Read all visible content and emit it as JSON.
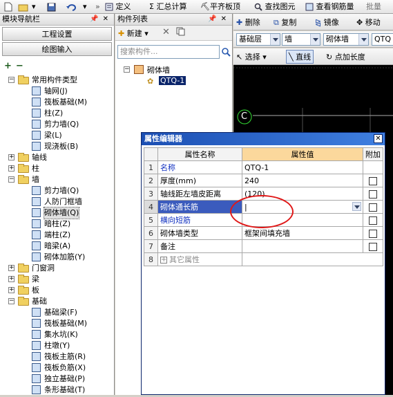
{
  "toolbar": {
    "define_label": "定义",
    "sum_label": "汇总计算",
    "flat_label": "平齐板顶",
    "find_label": "查找图元",
    "view_rebar_label": "查看钢筋量",
    "batch_label": "批量"
  },
  "leftnav": {
    "title": "模块导航栏",
    "project_settings": "工程设置",
    "drawing_input": "绘图输入",
    "tree": [
      {
        "label": "常用构件类型",
        "level": 0,
        "type": "folder",
        "expanded": true
      },
      {
        "label": "轴网(J)",
        "level": 1,
        "type": "item",
        "icon": "grid-icon"
      },
      {
        "label": "筏板基础(M)",
        "level": 1,
        "type": "item",
        "icon": "raft-icon"
      },
      {
        "label": "柱(Z)",
        "level": 1,
        "type": "item",
        "icon": "column-icon"
      },
      {
        "label": "剪力墙(Q)",
        "level": 1,
        "type": "item",
        "icon": "shear-wall-icon"
      },
      {
        "label": "梁(L)",
        "level": 1,
        "type": "item",
        "icon": "beam-icon"
      },
      {
        "label": "现浇板(B)",
        "level": 1,
        "type": "item",
        "icon": "slab-icon"
      },
      {
        "label": "轴线",
        "level": 0,
        "type": "folder",
        "expanded": false
      },
      {
        "label": "柱",
        "level": 0,
        "type": "folder",
        "expanded": false
      },
      {
        "label": "墙",
        "level": 0,
        "type": "folder",
        "expanded": true
      },
      {
        "label": "剪力墙(Q)",
        "level": 1,
        "type": "item",
        "icon": "shear-wall-icon"
      },
      {
        "label": "人防门框墙",
        "level": 1,
        "type": "item",
        "icon": "door-frame-wall-icon"
      },
      {
        "label": "砌体墙(Q)",
        "level": 1,
        "type": "item",
        "icon": "masonry-wall-icon",
        "selected": true
      },
      {
        "label": "暗柱(Z)",
        "level": 1,
        "type": "item",
        "icon": "hidden-column-icon"
      },
      {
        "label": "端柱(Z)",
        "level": 1,
        "type": "item",
        "icon": "end-column-icon"
      },
      {
        "label": "暗梁(A)",
        "level": 1,
        "type": "item",
        "icon": "hidden-beam-icon"
      },
      {
        "label": "砌体加筋(Y)",
        "level": 1,
        "type": "item",
        "icon": "masonry-rebar-icon"
      },
      {
        "label": "门窗洞",
        "level": 0,
        "type": "folder",
        "expanded": false
      },
      {
        "label": "梁",
        "level": 0,
        "type": "folder",
        "expanded": false
      },
      {
        "label": "板",
        "level": 0,
        "type": "folder",
        "expanded": false
      },
      {
        "label": "基础",
        "level": 0,
        "type": "folder",
        "expanded": true
      },
      {
        "label": "基础梁(F)",
        "level": 1,
        "type": "item",
        "icon": "foundation-beam-icon"
      },
      {
        "label": "筏板基础(M)",
        "level": 1,
        "type": "item",
        "icon": "raft-icon"
      },
      {
        "label": "集水坑(K)",
        "level": 1,
        "type": "item",
        "icon": "sump-icon"
      },
      {
        "label": "柱墩(Y)",
        "level": 1,
        "type": "item",
        "icon": "pier-icon"
      },
      {
        "label": "筏板主筋(R)",
        "level": 1,
        "type": "item",
        "icon": "raft-main-rebar-icon"
      },
      {
        "label": "筏板负筋(X)",
        "level": 1,
        "type": "item",
        "icon": "raft-neg-rebar-icon"
      },
      {
        "label": "独立基础(P)",
        "level": 1,
        "type": "item",
        "icon": "isolated-footing-icon"
      },
      {
        "label": "条形基础(T)",
        "level": 1,
        "type": "item",
        "icon": "strip-footing-icon"
      }
    ]
  },
  "complist": {
    "title": "构件列表",
    "new_label": "新建",
    "search_placeholder": "搜索构件...",
    "tree_root": "砌体墙",
    "tree_child": "QTQ-1"
  },
  "right": {
    "delete_label": "删除",
    "copy_label": "复制",
    "mirror_label": "镜像",
    "move_label": "移动",
    "floor_value": "基础层",
    "category_value": "墙",
    "type_value": "砌体墙",
    "comp_value": "QTQ",
    "select_label": "选择",
    "line_label": "直线",
    "point_length_label": "点加长度",
    "axis_label": "C"
  },
  "propeditor": {
    "title": "属性编辑器",
    "headers": {
      "name": "属性名称",
      "value": "属性值",
      "extra": "附加"
    },
    "rows": [
      {
        "num": "1",
        "name": "名称",
        "value": "QTQ-1",
        "blue": true,
        "check": false
      },
      {
        "num": "2",
        "name": "厚度(mm)",
        "value": "240",
        "blue": false,
        "check": true
      },
      {
        "num": "3",
        "name": "轴线距左墙皮距离",
        "value": "(120)",
        "blue": false,
        "check": true
      },
      {
        "num": "4",
        "name": "砌体通长筋",
        "value": "",
        "blue": false,
        "check": true,
        "selected": true
      },
      {
        "num": "5",
        "name": "横向短筋",
        "value": "",
        "blue": true,
        "check": true
      },
      {
        "num": "6",
        "name": "砌体墙类型",
        "value": "框架间填充墙",
        "blue": false,
        "check": true
      },
      {
        "num": "7",
        "name": "备注",
        "value": "",
        "blue": false,
        "check": true
      },
      {
        "num": "8",
        "name": "其它属性",
        "value": "",
        "blue": false,
        "check": false,
        "group": true
      }
    ]
  },
  "colors": {
    "selection": "#3b5bbd",
    "accent_header": "#fbd89c",
    "annotation": "#e01818",
    "title_bar": "#1c4fb3"
  }
}
